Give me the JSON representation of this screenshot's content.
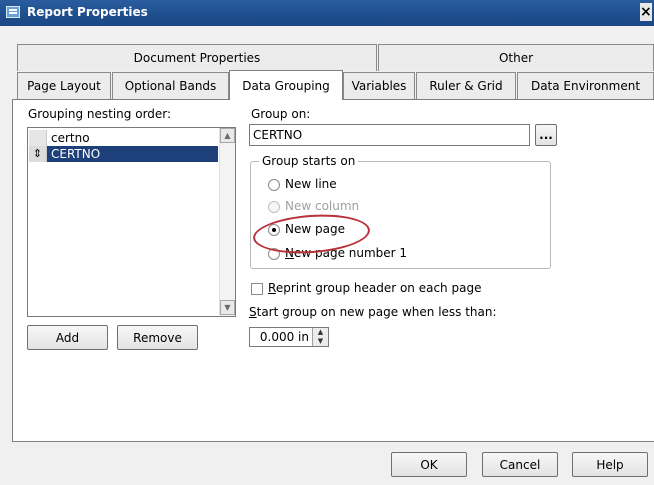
{
  "window": {
    "title": "Report Properties",
    "close_glyph": "×"
  },
  "tabs_row1": [
    {
      "label": "Document Properties"
    },
    {
      "label": "Other"
    }
  ],
  "tabs_row2": [
    {
      "label": "Page Layout"
    },
    {
      "label": "Optional Bands"
    },
    {
      "label": "Data Grouping",
      "active": true
    },
    {
      "label": "Variables"
    },
    {
      "label": "Ruler & Grid"
    },
    {
      "label": "Data Environment"
    }
  ],
  "grouping": {
    "label": "Grouping nesting order:",
    "items": [
      {
        "text": "certno",
        "marker": ""
      },
      {
        "text": "CERTNO",
        "marker": "⇕",
        "selected": true
      }
    ],
    "add_label": "Add",
    "remove_label": "Remove"
  },
  "group_on": {
    "label": "Group on:",
    "value": "CERTNO",
    "browse_label": "..."
  },
  "group_starts_on": {
    "legend": "Group starts on",
    "options": [
      {
        "label": "New line",
        "checked": false,
        "disabled": false
      },
      {
        "label": "New column",
        "checked": false,
        "disabled": true
      },
      {
        "label": "New page",
        "checked": true,
        "disabled": false
      },
      {
        "label": "New page number 1",
        "checked": false,
        "disabled": false
      }
    ]
  },
  "reprint": {
    "label": "Reprint group header on each page",
    "checked": false
  },
  "start_group": {
    "label": "Start group on new page when less than:",
    "value": "0.000 in"
  },
  "footer": {
    "ok_label": "OK",
    "cancel_label": "Cancel",
    "help_label": "Help"
  },
  "colors": {
    "selection": "#1d3f7a",
    "annotation": "#b8323a",
    "titlebar": "#1f4f8f"
  }
}
